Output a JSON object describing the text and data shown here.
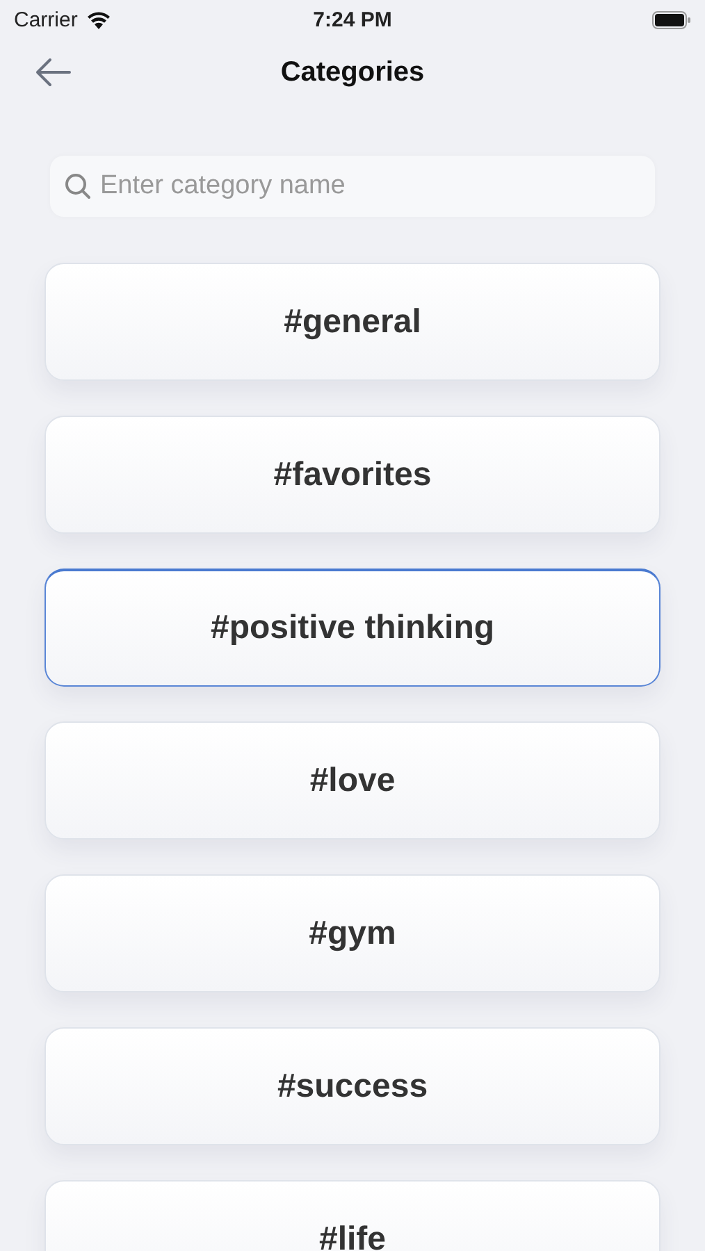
{
  "status_bar": {
    "carrier": "Carrier",
    "time": "7:24 PM"
  },
  "nav": {
    "title": "Categories"
  },
  "search": {
    "placeholder": "Enter category name"
  },
  "categories": [
    {
      "label": "#general",
      "selected": false
    },
    {
      "label": "#favorites",
      "selected": false
    },
    {
      "label": "#positive thinking",
      "selected": true
    },
    {
      "label": "#love",
      "selected": false
    },
    {
      "label": "#gym",
      "selected": false
    },
    {
      "label": "#success",
      "selected": false
    },
    {
      "label": "#life",
      "selected": false
    }
  ]
}
